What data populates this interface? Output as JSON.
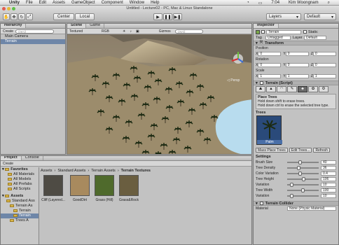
{
  "menubar": {
    "items": [
      "Unity",
      "File",
      "Edit",
      "Assets",
      "GameObject",
      "Component",
      "Window",
      "Help"
    ],
    "right": {
      "wifi": "4",
      "time": "7:04",
      "user": "Kim Woongnam",
      "icons": "search-icon"
    }
  },
  "window": {
    "title": "Untitled - Lecture02 - PC, Mac & Linux Standalone"
  },
  "toolbar": {
    "pivot_label": "Center",
    "space_label": "Local",
    "play": "▶",
    "pause": "❚❚",
    "step": "▶❚",
    "layers_label": "Layers",
    "layout_label": "Default"
  },
  "hierarchy": {
    "tab": "Hierarchy",
    "create_label": "Create",
    "search_placeholder": "Q▾All",
    "items": [
      "Main Camera",
      "Terrain"
    ]
  },
  "scene": {
    "tabs": [
      "Scene",
      "Game"
    ],
    "shading": "Textured",
    "render": "RGB",
    "gizmos": "Gizmos",
    "search": "Q▾All",
    "persp": "◁ Persp"
  },
  "inspector": {
    "tab": "Inspector",
    "object_name": "Terrain",
    "static_label": "Static",
    "tag_label": "Tag",
    "tag_value": "Untagged",
    "layer_label": "Layer",
    "layer_value": "Default",
    "transform": {
      "title": "Transform",
      "position_label": "Position",
      "rotation_label": "Rotation",
      "scale_label": "Scale",
      "position": {
        "x": "0",
        "y": "0",
        "z": "0"
      },
      "rotation": {
        "x": "0",
        "y": "0",
        "z": "0"
      },
      "scale": {
        "x": "1",
        "y": "1",
        "z": "1"
      }
    },
    "terrain_script": {
      "title": "Terrain (Script)",
      "mode_title": "Place Trees",
      "help1": "Hold down shift to erase trees.",
      "help2": "Hold down ctrl to erase the selected tree type.",
      "trees_label": "Trees",
      "tree_name": "Palm",
      "mass_place": "Mass Place Trees",
      "edit_trees": "Edit Trees...",
      "refresh": "Refresh"
    },
    "settings": {
      "title": "Settings",
      "rows": [
        {
          "label": "Brush Size",
          "value": "40",
          "level": 0.4
        },
        {
          "label": "Tree Density",
          "value": "36",
          "level": 0.36
        },
        {
          "label": "Color Variation",
          "value": "0.4",
          "level": 0.4
        },
        {
          "label": "Tree Height",
          "value": "106",
          "level": 0.53
        },
        {
          "label": "Variation",
          "value": "10",
          "level": 0.1
        },
        {
          "label": "Tree Width",
          "value": "100",
          "level": 0.5
        },
        {
          "label": "Variation",
          "value": "10",
          "level": 0.1
        }
      ]
    },
    "collider": {
      "title": "Terrain Collider",
      "material_label": "Material",
      "material_value": "None (Physic Material)"
    }
  },
  "project": {
    "tabs": [
      "Project",
      "Console"
    ],
    "create_label": "Create",
    "favorites_label": "Favorites",
    "favorites": [
      "All Materials",
      "All Models",
      "All Prefabs",
      "All Scripts"
    ],
    "assets_label": "Assets",
    "tree": [
      "Standard Ass",
      "Terrain As",
      "Terrain",
      "Terrain",
      "Trees A"
    ],
    "breadcrumb": [
      "Assets",
      "Standard Assets",
      "Terrain Assets",
      "Terrain Textures"
    ],
    "textures": [
      "Cliff (Layered...",
      "GoodDirt",
      "Grass (Hill)",
      "Grass&Rock"
    ]
  },
  "colors": {
    "bg": "#a8a8a8",
    "panel": "#c2c2c2",
    "select": "#6e86a8",
    "water": "#b8dcee",
    "sand": "#a89a7a",
    "tree": "#1c2a12"
  }
}
